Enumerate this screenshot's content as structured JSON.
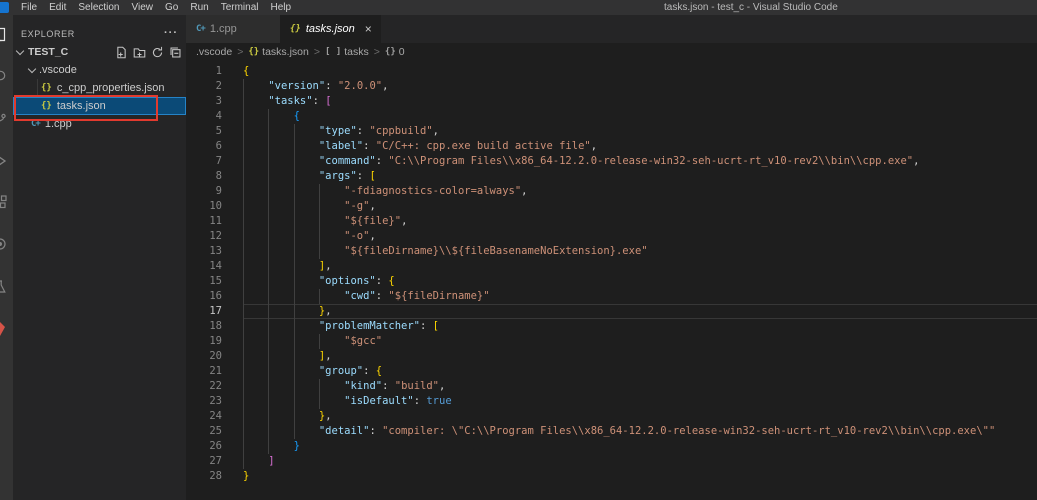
{
  "window": {
    "title": "tasks.json - test_c - Visual Studio Code",
    "menus": [
      "File",
      "Edit",
      "Selection",
      "View",
      "Go",
      "Run",
      "Terminal",
      "Help"
    ]
  },
  "activity_bar": {
    "icons": [
      "explorer",
      "search",
      "source-control",
      "run-debug",
      "extensions",
      "remote",
      "testing",
      "extension"
    ]
  },
  "sidebar": {
    "header": "EXPLORER",
    "more": "···",
    "project": "TEST_C",
    "items": [
      {
        "label": ".vscode",
        "type": "folder"
      },
      {
        "label": "c_cpp_properties.json",
        "type": "json"
      },
      {
        "label": "tasks.json",
        "type": "json",
        "selected": true,
        "annotated": true
      },
      {
        "label": "1.cpp",
        "type": "cpp"
      }
    ],
    "annotation_color": "#e23a2e"
  },
  "tabs": [
    {
      "label": "1.cpp",
      "icon": "C+",
      "active": false
    },
    {
      "label": "tasks.json",
      "icon": "{}",
      "active": true,
      "close": "×"
    }
  ],
  "breadcrumbs": {
    "items": [
      {
        "label": ".vscode",
        "icon": ""
      },
      {
        "label": "tasks.json",
        "icon": "{}"
      },
      {
        "label": "tasks",
        "icon": "[ ]"
      },
      {
        "label": "0",
        "icon": "{}"
      }
    ],
    "separator": ">"
  },
  "editor": {
    "active_line": 17,
    "colors": {
      "key": "#9cdcfe",
      "string": "#ce9178",
      "keyword": "#569cd6",
      "bracket1": "#ffd700",
      "bracket2": "#da70d6",
      "bracket3": "#179fff",
      "background": "#1e1e1e"
    },
    "lines": [
      {
        "n": 1,
        "g": 0,
        "t": [
          [
            "{",
            "b1"
          ]
        ]
      },
      {
        "n": 2,
        "g": 1,
        "t": [
          [
            "    ",
            ""
          ],
          [
            "\"version\"",
            "key"
          ],
          [
            ": ",
            "pun"
          ],
          [
            "\"2.0.0\"",
            "str"
          ],
          [
            ",",
            "pun"
          ]
        ]
      },
      {
        "n": 3,
        "g": 1,
        "t": [
          [
            "    ",
            ""
          ],
          [
            "\"tasks\"",
            "key"
          ],
          [
            ": ",
            "pun"
          ],
          [
            "[",
            "b2"
          ]
        ]
      },
      {
        "n": 4,
        "g": 2,
        "t": [
          [
            "        ",
            ""
          ],
          [
            "{",
            "b3"
          ]
        ]
      },
      {
        "n": 5,
        "g": 3,
        "t": [
          [
            "            ",
            ""
          ],
          [
            "\"type\"",
            "key"
          ],
          [
            ": ",
            "pun"
          ],
          [
            "\"cppbuild\"",
            "str"
          ],
          [
            ",",
            "pun"
          ]
        ]
      },
      {
        "n": 6,
        "g": 3,
        "t": [
          [
            "            ",
            ""
          ],
          [
            "\"label\"",
            "key"
          ],
          [
            ": ",
            "pun"
          ],
          [
            "\"C/C++: cpp.exe build active file\"",
            "str"
          ],
          [
            ",",
            "pun"
          ]
        ]
      },
      {
        "n": 7,
        "g": 3,
        "t": [
          [
            "            ",
            ""
          ],
          [
            "\"command\"",
            "key"
          ],
          [
            ": ",
            "pun"
          ],
          [
            "\"C:\\\\Program Files\\\\x86_64-12.2.0-release-win32-seh-ucrt-rt_v10-rev2\\\\bin\\\\cpp.exe\"",
            "str"
          ],
          [
            ",",
            "pun"
          ]
        ]
      },
      {
        "n": 8,
        "g": 3,
        "t": [
          [
            "            ",
            ""
          ],
          [
            "\"args\"",
            "key"
          ],
          [
            ": ",
            "pun"
          ],
          [
            "[",
            "b1"
          ]
        ]
      },
      {
        "n": 9,
        "g": 4,
        "t": [
          [
            "                ",
            ""
          ],
          [
            "\"-fdiagnostics-color=always\"",
            "str"
          ],
          [
            ",",
            "pun"
          ]
        ]
      },
      {
        "n": 10,
        "g": 4,
        "t": [
          [
            "                ",
            ""
          ],
          [
            "\"-g\"",
            "str"
          ],
          [
            ",",
            "pun"
          ]
        ]
      },
      {
        "n": 11,
        "g": 4,
        "t": [
          [
            "                ",
            ""
          ],
          [
            "\"${file}\"",
            "str"
          ],
          [
            ",",
            "pun"
          ]
        ]
      },
      {
        "n": 12,
        "g": 4,
        "t": [
          [
            "                ",
            ""
          ],
          [
            "\"-o\"",
            "str"
          ],
          [
            ",",
            "pun"
          ]
        ]
      },
      {
        "n": 13,
        "g": 4,
        "t": [
          [
            "                ",
            ""
          ],
          [
            "\"${fileDirname}\\\\${fileBasenameNoExtension}.exe\"",
            "str"
          ]
        ]
      },
      {
        "n": 14,
        "g": 3,
        "t": [
          [
            "            ",
            ""
          ],
          [
            "]",
            "b1"
          ],
          [
            ",",
            "pun"
          ]
        ]
      },
      {
        "n": 15,
        "g": 3,
        "t": [
          [
            "            ",
            ""
          ],
          [
            "\"options\"",
            "key"
          ],
          [
            ": ",
            "pun"
          ],
          [
            "{",
            "b1"
          ]
        ]
      },
      {
        "n": 16,
        "g": 4,
        "t": [
          [
            "                ",
            ""
          ],
          [
            "\"cwd\"",
            "key"
          ],
          [
            ": ",
            "pun"
          ],
          [
            "\"${fileDirname}\"",
            "str"
          ]
        ]
      },
      {
        "n": 17,
        "g": 3,
        "t": [
          [
            "            ",
            ""
          ],
          [
            "}",
            "b1"
          ],
          [
            ",",
            "pun"
          ]
        ]
      },
      {
        "n": 18,
        "g": 3,
        "t": [
          [
            "            ",
            ""
          ],
          [
            "\"problemMatcher\"",
            "key"
          ],
          [
            ": ",
            "pun"
          ],
          [
            "[",
            "b1"
          ]
        ]
      },
      {
        "n": 19,
        "g": 4,
        "t": [
          [
            "                ",
            ""
          ],
          [
            "\"$gcc\"",
            "str"
          ]
        ]
      },
      {
        "n": 20,
        "g": 3,
        "t": [
          [
            "            ",
            ""
          ],
          [
            "]",
            "b1"
          ],
          [
            ",",
            "pun"
          ]
        ]
      },
      {
        "n": 21,
        "g": 3,
        "t": [
          [
            "            ",
            ""
          ],
          [
            "\"group\"",
            "key"
          ],
          [
            ": ",
            "pun"
          ],
          [
            "{",
            "b1"
          ]
        ]
      },
      {
        "n": 22,
        "g": 4,
        "t": [
          [
            "                ",
            ""
          ],
          [
            "\"kind\"",
            "key"
          ],
          [
            ": ",
            "pun"
          ],
          [
            "\"build\"",
            "str"
          ],
          [
            ",",
            "pun"
          ]
        ]
      },
      {
        "n": 23,
        "g": 4,
        "t": [
          [
            "                ",
            ""
          ],
          [
            "\"isDefault\"",
            "key"
          ],
          [
            ": ",
            "pun"
          ],
          [
            "true",
            "kw"
          ]
        ]
      },
      {
        "n": 24,
        "g": 3,
        "t": [
          [
            "            ",
            ""
          ],
          [
            "}",
            "b1"
          ],
          [
            ",",
            "pun"
          ]
        ]
      },
      {
        "n": 25,
        "g": 3,
        "t": [
          [
            "            ",
            ""
          ],
          [
            "\"detail\"",
            "key"
          ],
          [
            ": ",
            "pun"
          ],
          [
            "\"compiler: \\\"C:\\\\Program Files\\\\x86_64-12.2.0-release-win32-seh-ucrt-rt_v10-rev2\\\\bin\\\\cpp.exe\\\"\"",
            "str"
          ]
        ]
      },
      {
        "n": 26,
        "g": 2,
        "t": [
          [
            "        ",
            ""
          ],
          [
            "}",
            "b3"
          ]
        ]
      },
      {
        "n": 27,
        "g": 1,
        "t": [
          [
            "    ",
            ""
          ],
          [
            "]",
            "b2"
          ]
        ]
      },
      {
        "n": 28,
        "g": 0,
        "t": [
          [
            "}",
            "b1"
          ]
        ]
      }
    ]
  }
}
